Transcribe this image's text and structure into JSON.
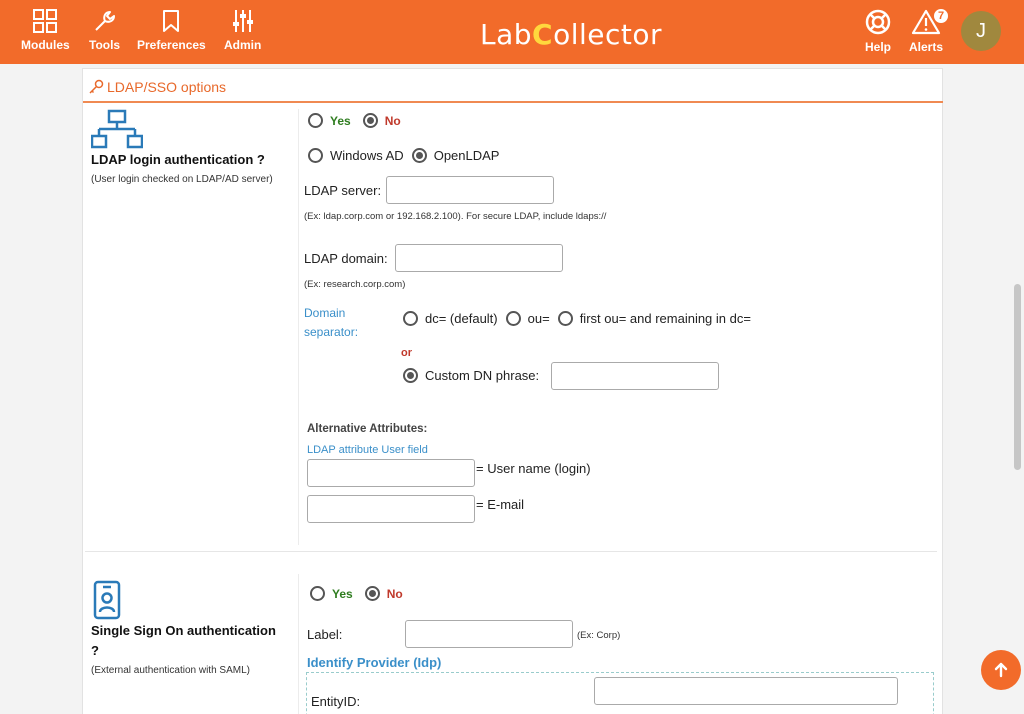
{
  "nav": {
    "modules": "Modules",
    "tools": "Tools",
    "preferences": "Preferences",
    "admin": "Admin",
    "help": "Help",
    "alerts": "Alerts",
    "alerts_count": "7",
    "avatar_initial": "J"
  },
  "logo": {
    "text_left": "Lab",
    "text_right": "ollector",
    "flask_letter": "C"
  },
  "panel": {
    "title": "LDAP/SSO options"
  },
  "ldap": {
    "title": "LDAP login authentication ?",
    "subtitle": "(User login checked on LDAP/AD server)",
    "yes_label": "Yes",
    "no_label": "No",
    "enabled": "No",
    "type_windows": "Windows AD",
    "type_openldap": "OpenLDAP",
    "server_label": "LDAP server:",
    "server_value": "",
    "server_hint": "(Ex: ldap.corp.com or 192.168.2.100). For secure LDAP, include ldaps://",
    "domain_label": "LDAP domain:",
    "domain_value": "",
    "domain_hint": "(Ex: research.corp.com)",
    "separator_label_1": "Domain",
    "separator_label_2": "separator:",
    "sep_dc": "dc= (default)",
    "sep_ou": "ou=",
    "sep_first_ou": "first ou= and remaining in dc=",
    "or_label": "or",
    "custom_dn_label": "Custom DN phrase:",
    "custom_dn_value": "",
    "alt_attr_title": "Alternative Attributes:",
    "alt_attr_sub": "LDAP attribute User field",
    "username_map": "= User name (login)",
    "email_map": "= E-mail"
  },
  "sso": {
    "title_line1": "Single Sign On authentication",
    "title_line2": "?",
    "subtitle": "(External authentication with SAML)",
    "yes_label": "Yes",
    "no_label": "No",
    "enabled": "No",
    "label_label": "Label:",
    "label_value": "",
    "label_hint": "(Ex: Corp)",
    "idp_title": "Identify Provider (Idp)",
    "entity_label": "EntityID:",
    "entity_value": ""
  },
  "colors": {
    "brand": "#f26b2a",
    "yes": "#2f7d20",
    "no": "#c0392b",
    "link": "#3a8fc9"
  }
}
